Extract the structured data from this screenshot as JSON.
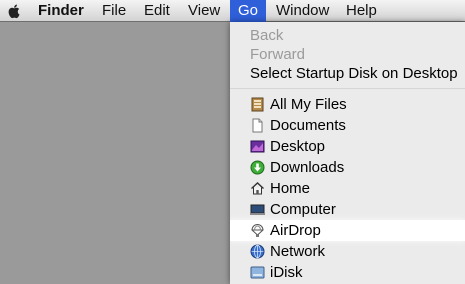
{
  "menubar": {
    "finder": "Finder",
    "file": "File",
    "edit": "Edit",
    "view": "View",
    "go": "Go",
    "window": "Window",
    "help": "Help"
  },
  "go_menu": {
    "back": "Back",
    "forward": "Forward",
    "startup": "Select Startup Disk on Desktop",
    "all_my_files": "All My Files",
    "documents": "Documents",
    "desktop": "Desktop",
    "downloads": "Downloads",
    "home": "Home",
    "computer": "Computer",
    "airdrop": "AirDrop",
    "network": "Network",
    "idisk": "iDisk"
  },
  "icons": {
    "apple": "apple-icon",
    "all_my_files": "all-my-files-icon",
    "documents": "documents-icon",
    "desktop": "desktop-icon",
    "downloads": "downloads-icon",
    "home": "home-icon",
    "computer": "computer-icon",
    "airdrop": "airdrop-icon",
    "network": "network-icon",
    "idisk": "idisk-icon"
  },
  "colors": {
    "menu_highlight": "#2f5fd9",
    "disabled_text": "#9a9a9a"
  }
}
